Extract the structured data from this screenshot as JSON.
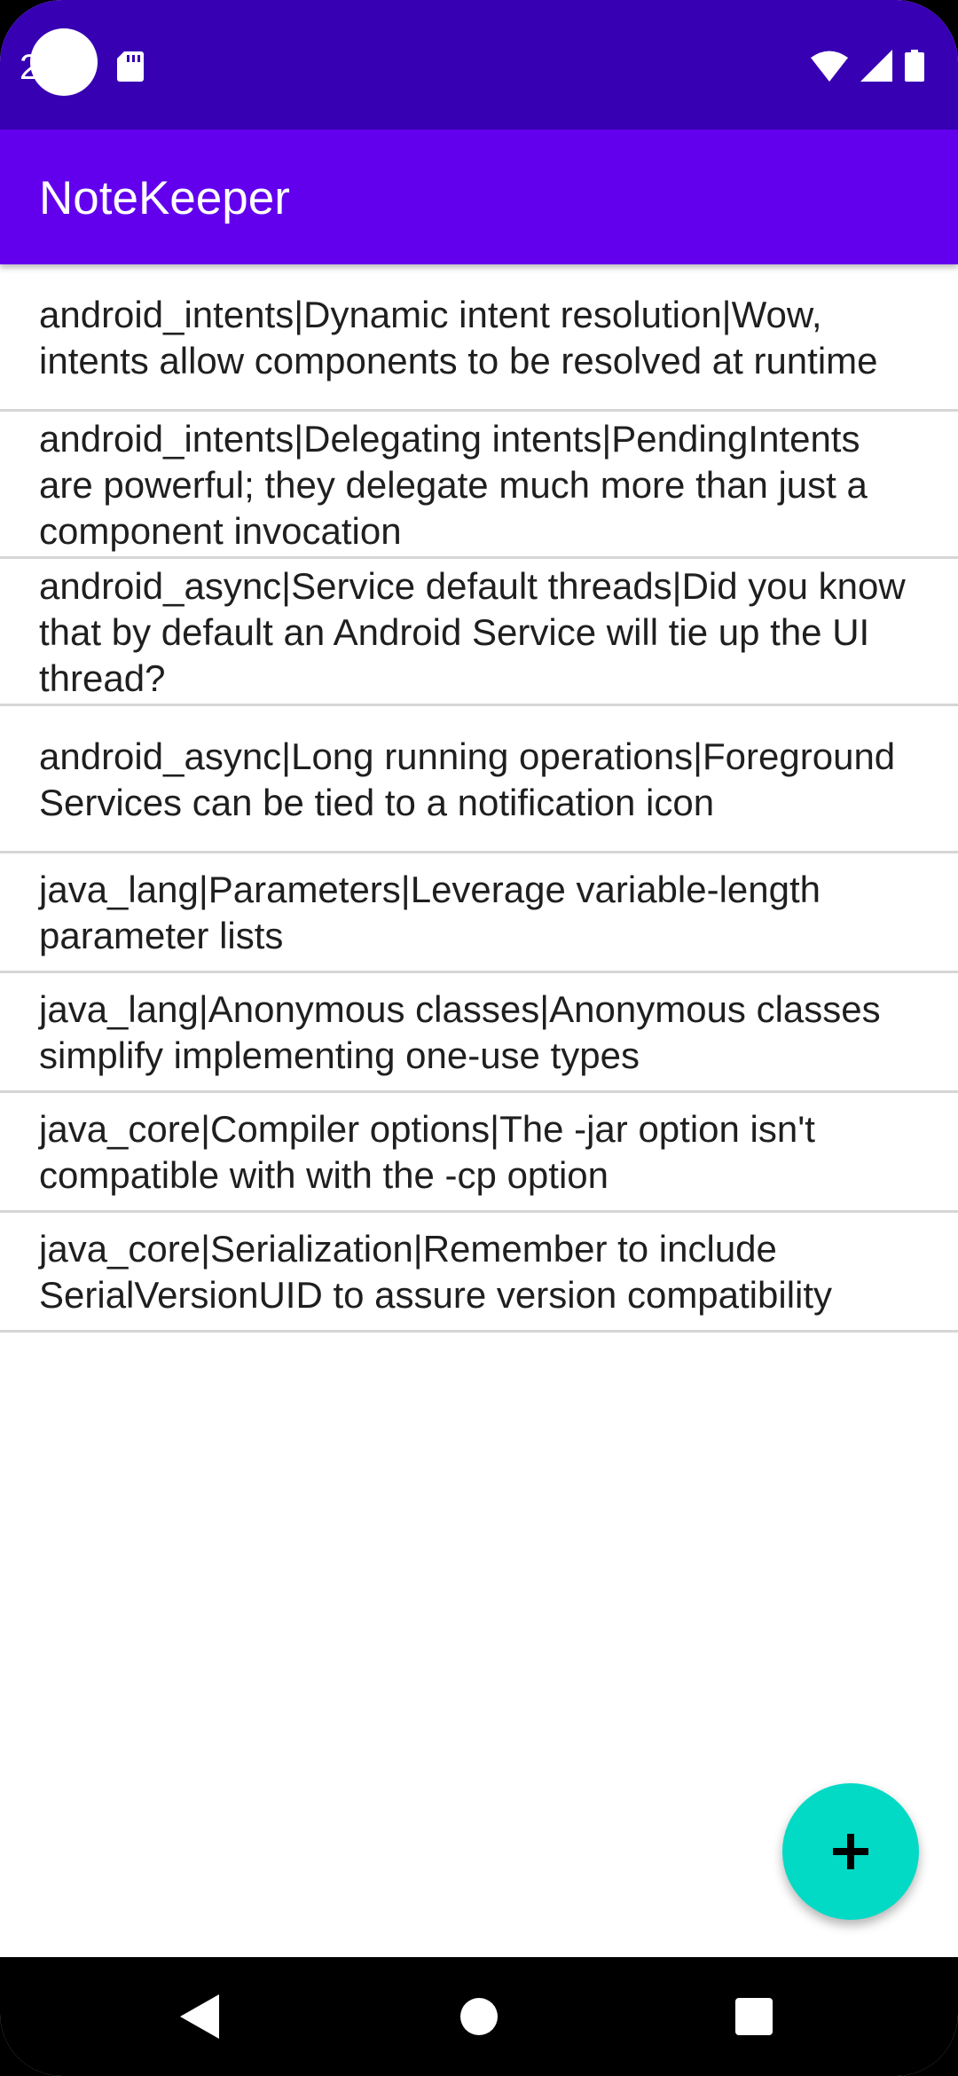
{
  "status_bar": {
    "time": "2",
    "icons": [
      "camera-cutout",
      "sd-card-icon",
      "wifi-icon",
      "signal-icon",
      "battery-icon"
    ]
  },
  "app_bar": {
    "title": "NoteKeeper"
  },
  "notes": [
    {
      "text": "android_intents|Dynamic intent resolution|Wow, intents allow components to be resolved at runtime"
    },
    {
      "text": "android_intents|Delegating intents|PendingIntents are powerful; they delegate much more than just a component invocation"
    },
    {
      "text": "android_async|Service default threads|Did you know that by default an Android Service will tie up the UI thread?"
    },
    {
      "text": "android_async|Long running operations|Foreground Services can be tied to a notification icon"
    },
    {
      "text": "java_lang|Parameters|Leverage variable-length parameter lists"
    },
    {
      "text": "java_lang|Anonymous classes|Anonymous classes simplify implementing one-use types"
    },
    {
      "text": "java_core|Compiler options|The -jar option isn't compatible with with the -cp option"
    },
    {
      "text": "java_core|Serialization|Remember to include SerialVersionUID to assure version compatibility"
    }
  ],
  "fab": {
    "icon": "plus-icon"
  },
  "nav_bar": {
    "icons": [
      "back-icon",
      "home-icon",
      "recents-icon"
    ]
  },
  "colors": {
    "status_bar": "#3700b3",
    "app_bar": "#6200ee",
    "fab": "#03dac5",
    "divider": "#d6d6d6",
    "nav_bar": "#000000"
  }
}
